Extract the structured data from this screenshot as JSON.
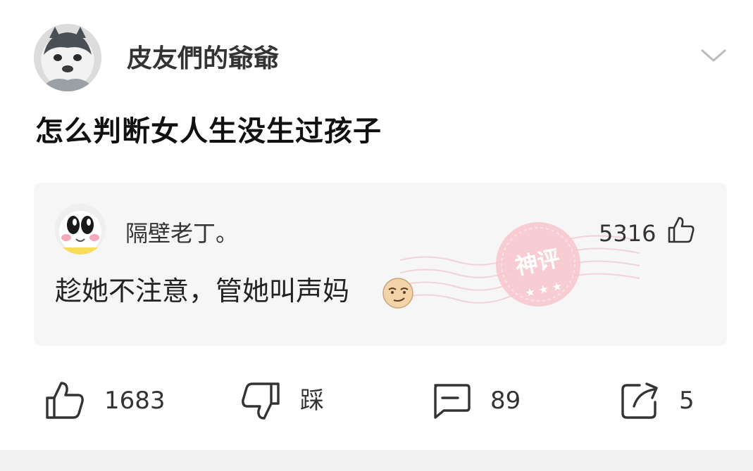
{
  "post": {
    "author": "皮友們的爺爺",
    "title": "怎么判断女人生没生过孩子"
  },
  "top_comment": {
    "author": "隔壁老丁。",
    "likes": "5316",
    "text": "趁她不注意，管她叫声妈",
    "badge_text": "神评"
  },
  "actions": {
    "like_count": "1683",
    "dislike_label": "踩",
    "comment_count": "89",
    "share_count": "5"
  },
  "colors": {
    "card_bg": "#f6f6f6",
    "badge": "#f6c9cf",
    "text": "#222222"
  },
  "icons": [
    "avatar-husky",
    "chevron-down-icon",
    "thumbs-up-icon",
    "thumbs-down-icon",
    "comment-icon",
    "share-icon"
  ]
}
